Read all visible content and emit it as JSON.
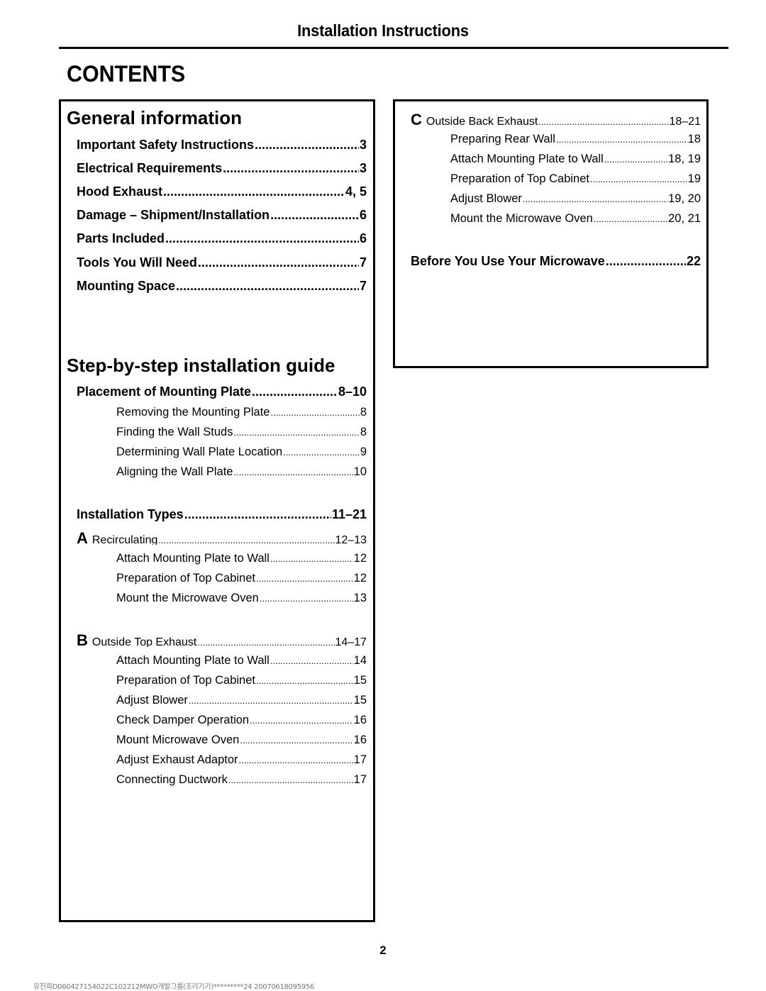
{
  "header": {
    "title": "Installation Instructions"
  },
  "contents_title": "CONTENTS",
  "general": {
    "heading": "General information",
    "items": [
      {
        "label": "Important Safety Instructions ",
        "page": "3"
      },
      {
        "label": "Electrical Requirements ",
        "page": "3"
      },
      {
        "label": "Hood Exhaust ",
        "page": "4, 5"
      },
      {
        "label": "Damage – Shipment/Installation ",
        "page": "6"
      },
      {
        "label": "Parts Included",
        "page": "6"
      },
      {
        "label": "Tools You Will Need ",
        "page": "7"
      },
      {
        "label": "Mounting Space",
        "page": "7"
      }
    ]
  },
  "guide": {
    "heading": "Step-by-step installation guide",
    "placement": {
      "label": "Placement of Mounting Plate ",
      "page": "8–10",
      "items": [
        {
          "label": "Removing the Mounting Plate ",
          "page": " 8"
        },
        {
          "label": "Finding the Wall Studs ",
          "page": " 8"
        },
        {
          "label": "Determining Wall Plate Location ",
          "page": " 9"
        },
        {
          "label": "Aligning the Wall Plate ",
          "page": " 10"
        }
      ]
    },
    "types": {
      "label": "Installation Types ",
      "page": "11–21",
      "A": {
        "letter": "A",
        "label": "Recirculating ",
        "page": " 12–13",
        "items": [
          {
            "label": "Attach Mounting Plate to Wall ",
            "page": " 12"
          },
          {
            "label": "Preparation of Top Cabinet ",
            "page": " 12"
          },
          {
            "label": "Mount the Microwave Oven",
            "page": " 13"
          }
        ]
      },
      "B": {
        "letter": "B",
        "label": "Outside Top Exhaust ",
        "page": " 14–17",
        "items": [
          {
            "label": "Attach Mounting Plate to Wall ",
            "page": " 14"
          },
          {
            "label": "Preparation of Top Cabinet ",
            "page": " 15"
          },
          {
            "label": "Adjust Blower ",
            "page": " 15"
          },
          {
            "label": "Check Damper Operation",
            "page": " 16"
          },
          {
            "label": "Mount Microwave Oven",
            "page": " 16"
          },
          {
            "label": "Adjust Exhaust Adaptor",
            "page": " 17"
          },
          {
            "label": "Connecting Ductwork ",
            "page": " 17"
          }
        ]
      },
      "C": {
        "letter": "C",
        "label": "Outside Back Exhaust",
        "page": " 18–21",
        "items": [
          {
            "label": "Preparing Rear Wall ",
            "page": " 18"
          },
          {
            "label": "Attach Mounting Plate to Wall ",
            "page": " 18, 19"
          },
          {
            "label": "Preparation of Top Cabinet ",
            "page": " 19"
          },
          {
            "label": "Adjust Blower ",
            "page": " 19, 20"
          },
          {
            "label": "Mount the Microwave Oven",
            "page": " 20, 21"
          }
        ]
      }
    },
    "before_use": {
      "label": "Before You Use Your Microwave ",
      "page": "22"
    }
  },
  "page_number": "2",
  "footer_code": "유진희D060427154022C102212MWO개발그룹(조리기기)*********24 20070618095956"
}
